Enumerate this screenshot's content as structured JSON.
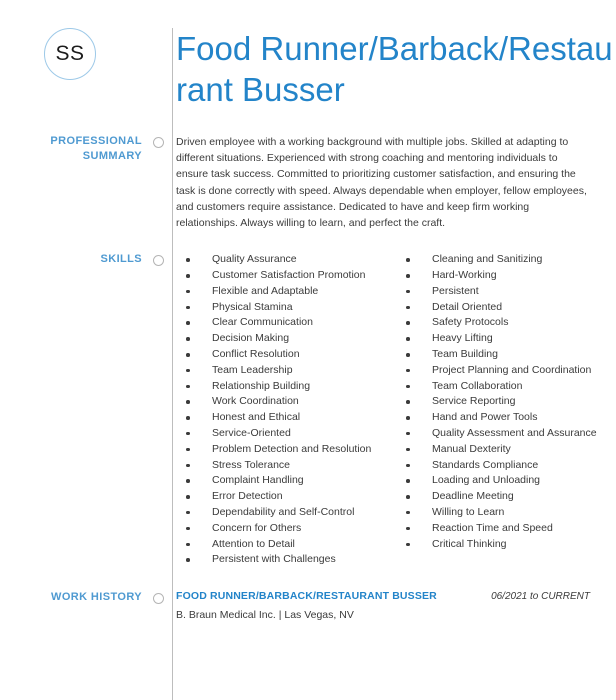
{
  "header": {
    "monogram": "SS",
    "name_title": "Food Runner/Barback/Restaurant Busser",
    "accent_color": "#2384c9"
  },
  "sections": {
    "summary": {
      "label_line1": "PROFESSIONAL",
      "label_line2": "SUMMARY",
      "text": "Driven employee with a working background with multiple jobs. Skilled at adapting to different situations. Experienced with strong coaching and mentoring individuals to ensure task success. Committed to prioritizing customer satisfaction, and ensuring the task is done correctly with speed. Always dependable when employer, fellow employees, and customers require assistance. Dedicated to have and keep firm working relationships. Always willing to learn, and perfect the craft."
    },
    "skills": {
      "label": "SKILLS",
      "left_column": [
        "Quality Assurance",
        "Customer Satisfaction Promotion",
        "Flexible and Adaptable",
        "Physical Stamina",
        "Clear Communication",
        "Decision Making",
        "Conflict Resolution",
        "Team Leadership",
        "Relationship Building",
        "Work Coordination",
        "Honest and Ethical",
        "Service-Oriented",
        "Problem Detection and Resolution",
        "Stress Tolerance",
        "Complaint Handling",
        "Error Detection",
        "Dependability and Self-Control",
        "Concern for Others",
        "Attention to Detail",
        "Persistent with Challenges"
      ],
      "right_column": [
        "Cleaning and Sanitizing",
        "Hard-Working",
        "Persistent",
        "Detail Oriented",
        "Safety Protocols",
        "Heavy Lifting",
        "Team Building",
        "Project Planning and Coordination",
        "Team Collaboration",
        "Service Reporting",
        "Hand and Power Tools",
        "Quality Assessment and Assurance",
        "Manual Dexterity",
        "Standards Compliance",
        "Loading and Unloading",
        "Deadline Meeting",
        "Willing to Learn",
        "Reaction Time and Speed",
        "Critical Thinking"
      ]
    },
    "work_history": {
      "label": "WORK HISTORY",
      "jobs": [
        {
          "title": "FOOD RUNNER/BARBACK/RESTAURANT BUSSER",
          "dates": "06/2021 to CURRENT",
          "company": "B. Braun Medical Inc. | Las Vegas, NV"
        }
      ]
    }
  }
}
